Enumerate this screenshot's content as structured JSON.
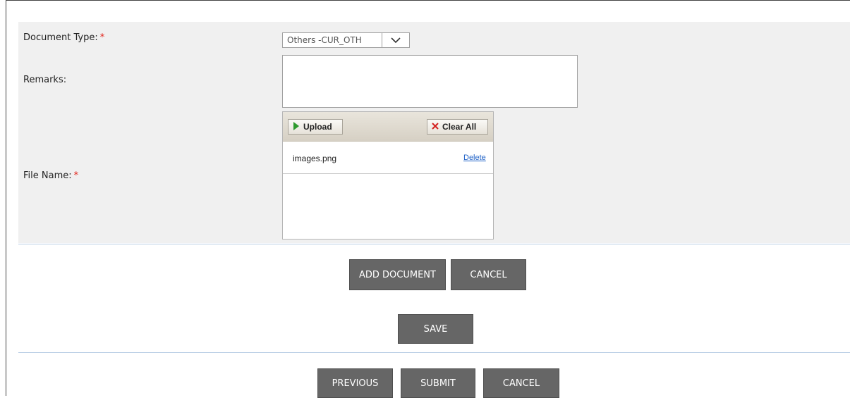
{
  "form": {
    "document_type_label": "Document Type:",
    "remarks_label": "Remarks:",
    "file_name_label": "File Name:",
    "required_marker": "*",
    "document_type_value": "Others -CUR_OTH",
    "remarks_value": ""
  },
  "uploader": {
    "upload_label": "Upload",
    "clear_all_label": "Clear All",
    "files": [
      {
        "name": "images.png",
        "action": "Delete"
      }
    ]
  },
  "actions": {
    "add_document": "ADD DOCUMENT",
    "cancel": "CANCEL",
    "save": "SAVE"
  },
  "footer": {
    "previous": "PREVIOUS",
    "submit": "SUBMIT",
    "cancel": "CANCEL"
  },
  "colors": {
    "required": "#e2231a",
    "button_bg": "#666666",
    "link": "#1f62c7",
    "panel_bg": "#f0f0f0",
    "divider": "#b9cde5"
  },
  "icons": {
    "upload": "green-play-arrow-icon",
    "clear_all": "red-x-icon",
    "dropdown": "chevron-down-icon"
  }
}
